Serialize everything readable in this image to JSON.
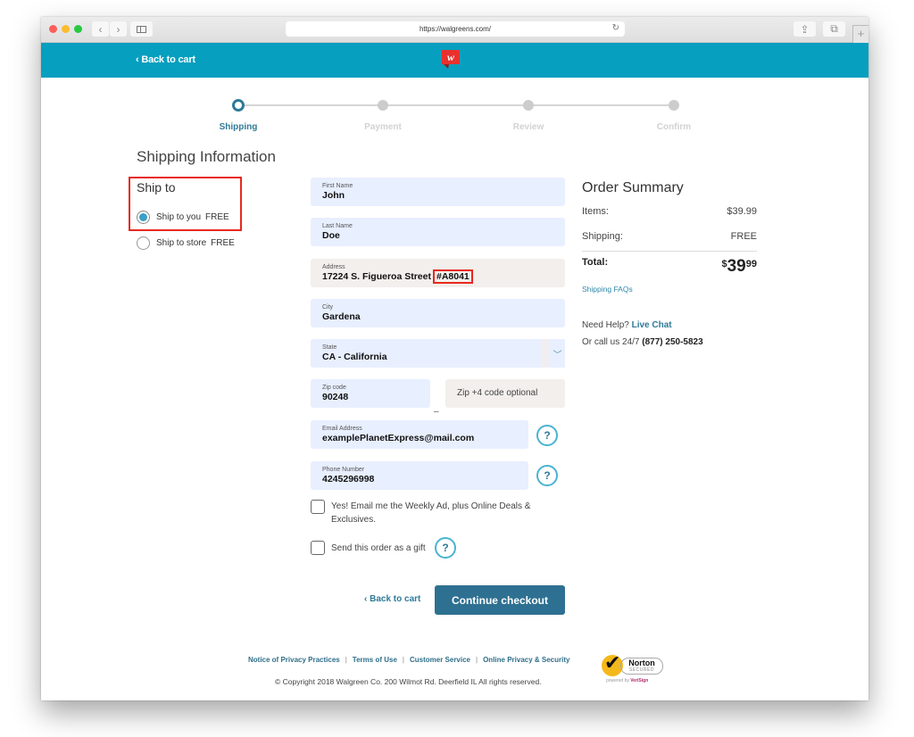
{
  "browser": {
    "url": "https://walgreens.com/",
    "reload_icon": "↻",
    "back_icon": "‹",
    "forward_icon": "›",
    "share_icon": "⇪",
    "tabs_icon": "⧉",
    "new_tab_icon": "+"
  },
  "header": {
    "back_to_cart": "‹ Back to cart",
    "logo_letter": "W",
    "brand_color": "#069fbf",
    "logo_color": "#e8312f"
  },
  "progress": {
    "steps": [
      {
        "label": "Shipping",
        "active": true
      },
      {
        "label": "Payment",
        "active": false
      },
      {
        "label": "Review",
        "active": false
      },
      {
        "label": "Confirm",
        "active": false
      }
    ]
  },
  "page": {
    "title": "Shipping Information"
  },
  "ship_to": {
    "heading": "Ship to",
    "options": [
      {
        "label": "Ship to you",
        "price": "FREE",
        "selected": true
      },
      {
        "label": "Ship to store",
        "price": "FREE",
        "selected": false
      }
    ]
  },
  "form": {
    "first_name": {
      "label": "First Name",
      "value": "John"
    },
    "last_name": {
      "label": "Last Name",
      "value": "Doe"
    },
    "address": {
      "label": "Address",
      "value": "17224 S. Figueroa Street",
      "highlight": "#A8041"
    },
    "city": {
      "label": "City",
      "value": "Gardena"
    },
    "state": {
      "label": "State",
      "value": "CA - California",
      "chevron_icon": "﹀"
    },
    "zip": {
      "label": "Zip code",
      "value": "90248"
    },
    "zip_dash": "–",
    "zip4": {
      "placeholder": "Zip +4 code optional"
    },
    "email": {
      "label": "Email Address",
      "value": "examplePlanetExpress@mail.com"
    },
    "phone": {
      "label": "Phone Number",
      "value": "4245296998"
    },
    "help_glyph": "?",
    "weekly_ad": {
      "label": "Yes! Email me the Weekly Ad, plus Online Deals & Exclusives.",
      "checked": false
    },
    "gift": {
      "label": "Send this order as a gift",
      "checked": false
    }
  },
  "actions": {
    "back_to_cart": "‹ Back to cart",
    "continue": "Continue checkout"
  },
  "summary": {
    "title": "Order Summary",
    "items_label": "Items:",
    "items_value": "$39.99",
    "shipping_label": "Shipping:",
    "shipping_value": "FREE",
    "total_label": "Total:",
    "total_currency": "$",
    "total_dollars": "39",
    "total_cents": "99",
    "shipping_faqs": "Shipping FAQs",
    "need_help": "Need Help?",
    "live_chat": "Live Chat",
    "call_us": "Or call us 24/7",
    "phone": "(877) 250-5823"
  },
  "footer": {
    "links": [
      "Notice of Privacy Practices",
      "Terms of Use",
      "Customer Service",
      "Online Privacy & Security"
    ],
    "separator": "|",
    "copyright": "© Copyright 2018 Walgreen Co. 200 Wilmot Rd. Deerfield IL All rights reserved.",
    "norton": {
      "name": "Norton",
      "secured": "SECURED",
      "powered": "powered by",
      "verisign": "VeriSign"
    }
  }
}
